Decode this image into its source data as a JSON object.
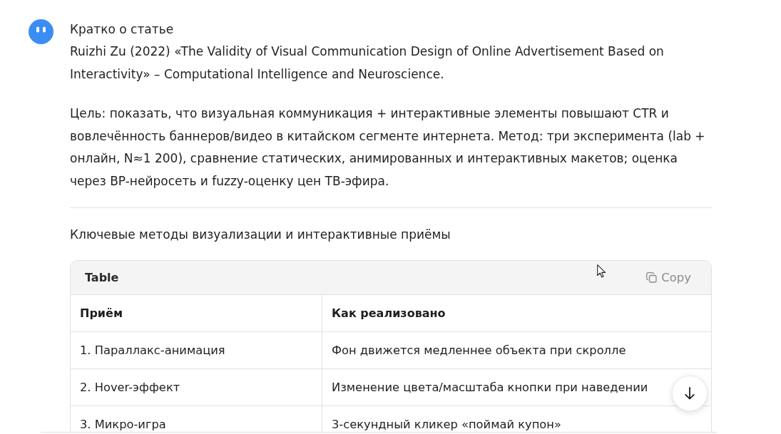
{
  "message": {
    "title": "Кратко о статье",
    "paragraphs": [
      "Ruizhi Zu (2022) «The Validity of Visual Communication Design of Online Advertisement Based on Interactivity» – Computational Intelligence and Neuroscience.",
      "Цель: показать, что визуальная коммуникация + интерактивные элементы повышают CTR и вовлечённость баннеров/видео в китайском сегменте интернета. Метод: три эксперимента (lab + онлайн, N≈1 200), сравнение статических, анимированных и интерактивных макетов; оценка через BP-нейросеть и fuzzy-оценку цен ТВ-эфира."
    ]
  },
  "section_heading": "Ключевые методы визуализации и интерактивные приёмы",
  "table": {
    "label": "Table",
    "copy_button": "Copy",
    "columns": [
      "Приём",
      "Как реализовано"
    ],
    "rows": [
      [
        "1. Параллакс-анимация",
        "Фон движется медленнее объекта при скролле"
      ],
      [
        "2. Hover-эффект",
        "Изменение цвета/масштаба кнопки при наведении"
      ],
      [
        "3. Микро-игра",
        "3-секундный кликер «поймай купон»"
      ]
    ]
  }
}
